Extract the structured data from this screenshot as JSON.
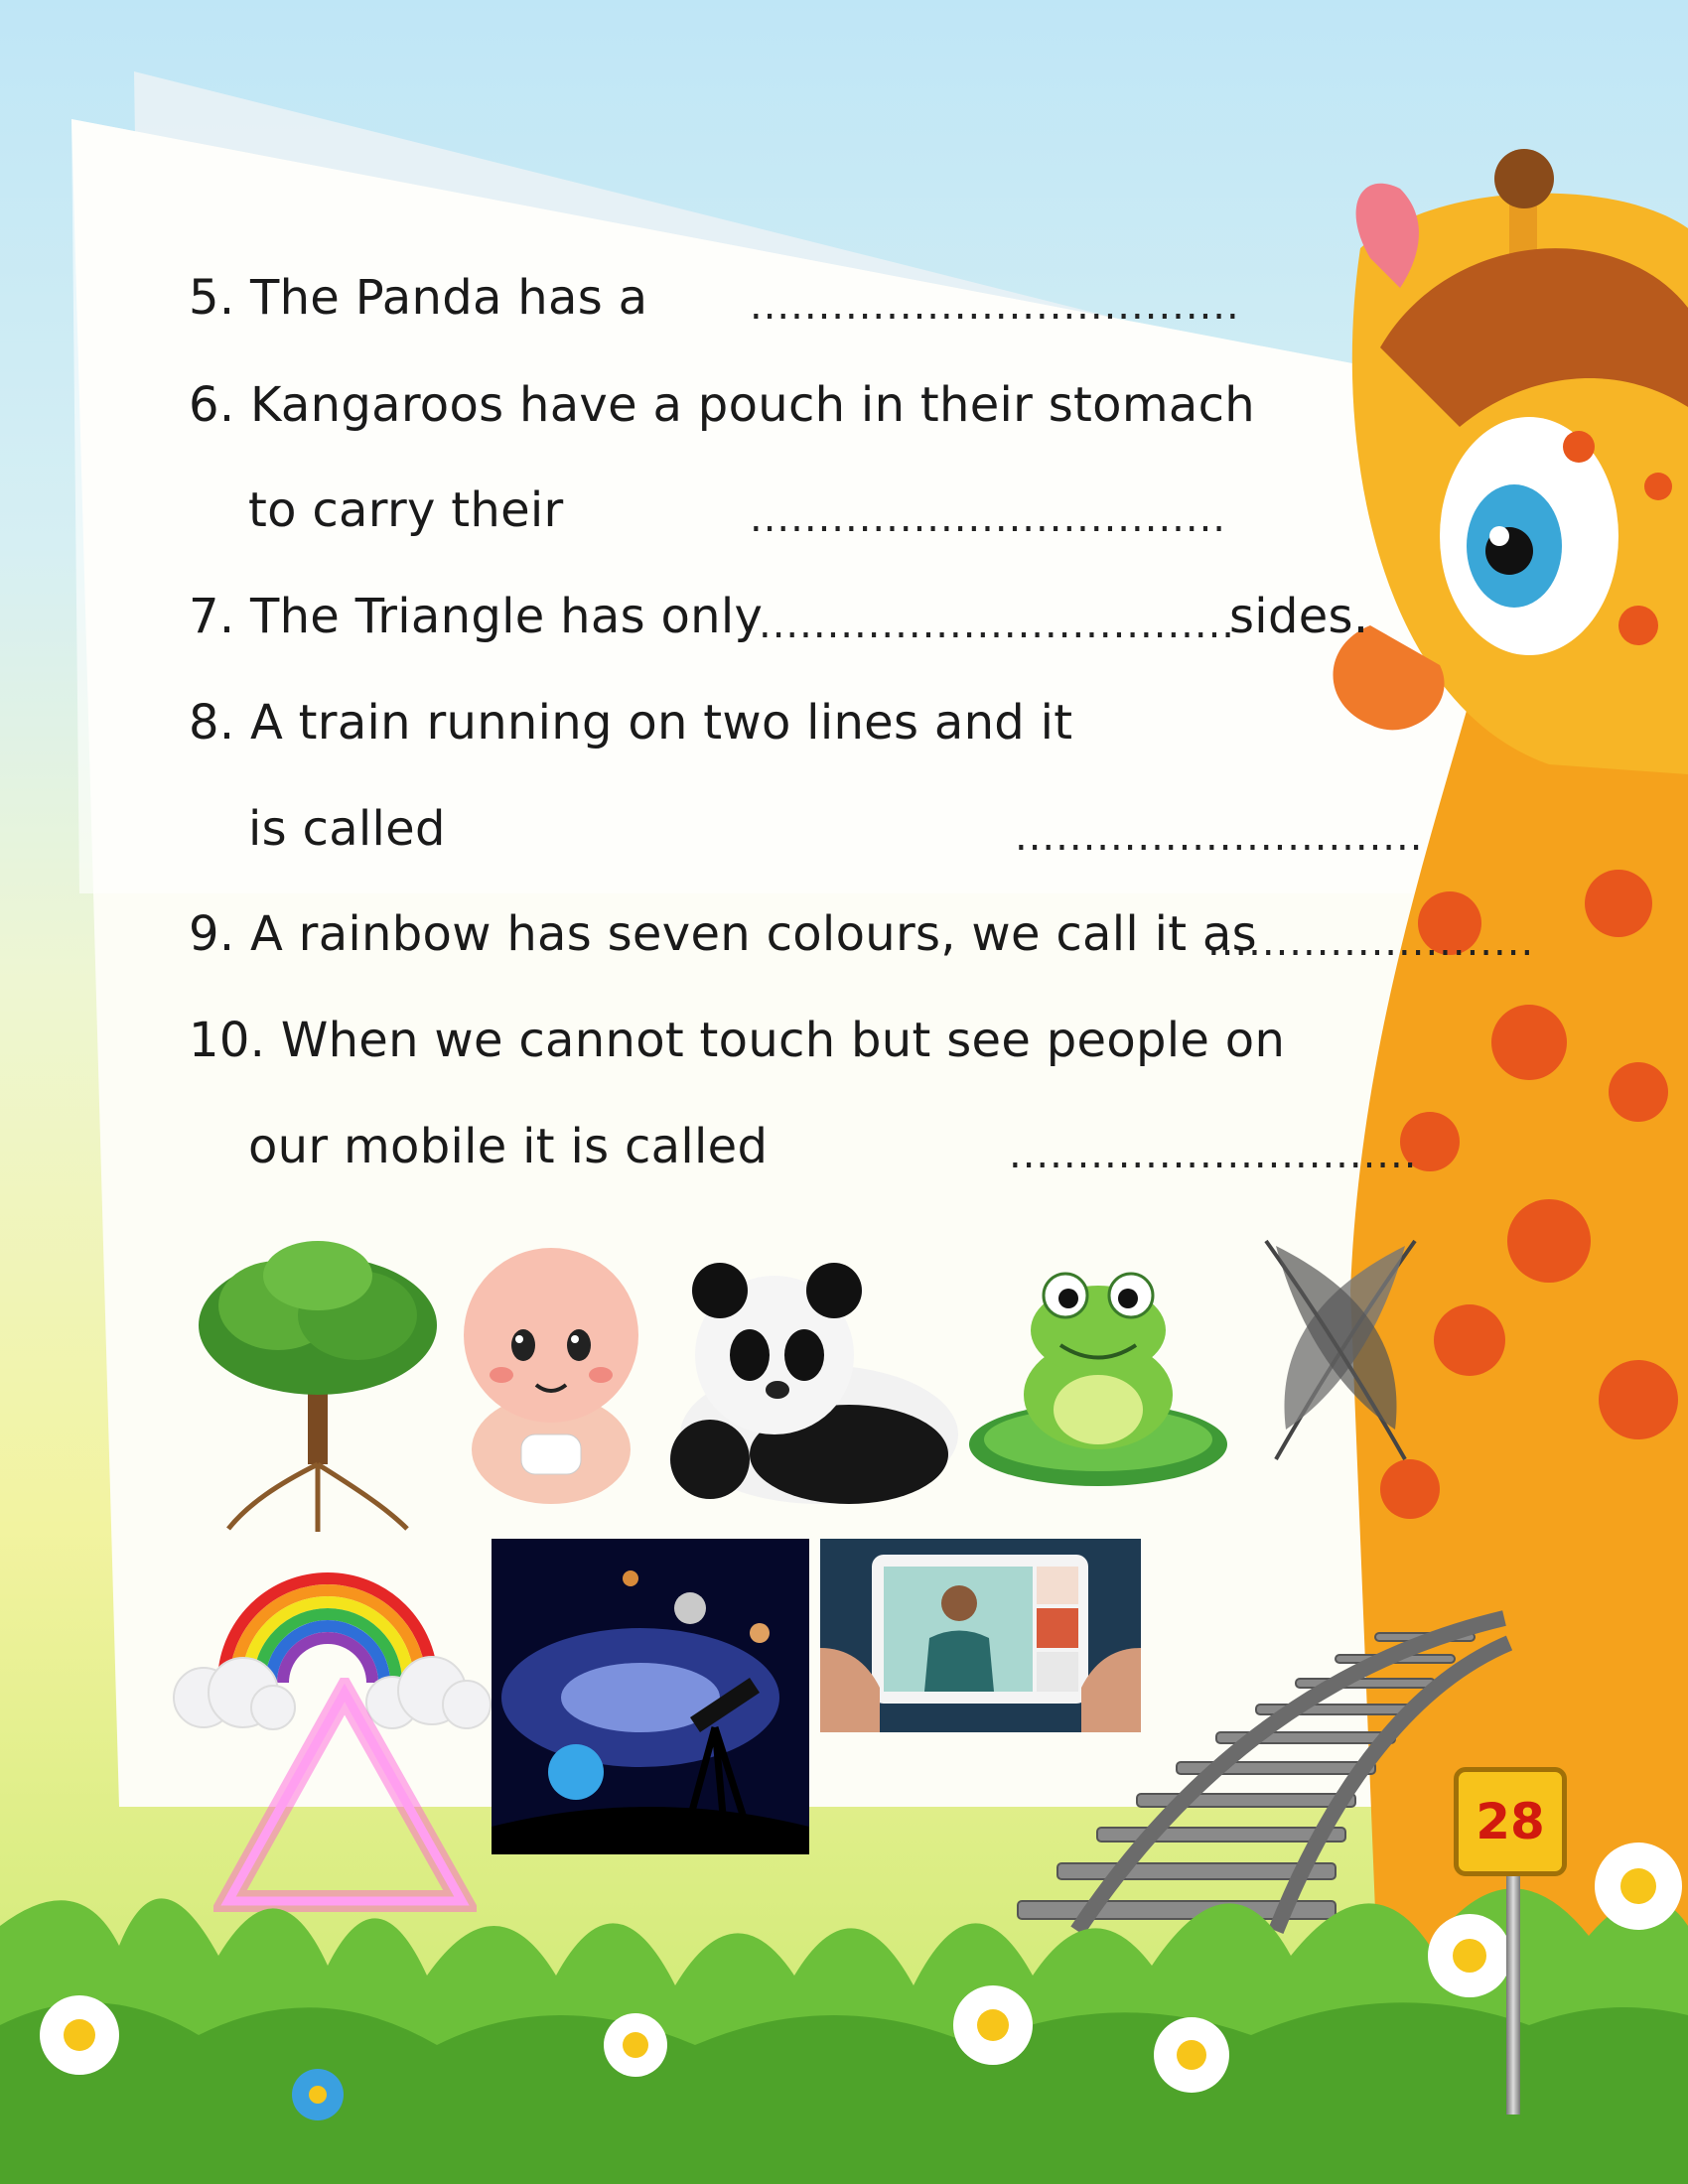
{
  "questions": [
    {
      "num": "5.",
      "text": "The Panda has a",
      "blank": "...................................."
    },
    {
      "num": "6.",
      "text": "Kangaroos have a pouch in their stomach",
      "line2": "to carry their",
      "blank": "..................................."
    },
    {
      "num": "7.",
      "text": "The Triangle has only",
      "blank": "...................................",
      "suffix": "sides."
    },
    {
      "num": "8.",
      "text": "A train running on two lines and it",
      "line2": "is called",
      "blank": ".............................."
    },
    {
      "num": "9.",
      "text": "A rainbow has seven colours, we call it as",
      "blank": "........................"
    },
    {
      "num": "10.",
      "text": "When we cannot touch but see people on",
      "line2": "our mobile it is called",
      "blank": ".............................."
    }
  ],
  "page_number": "28",
  "pictures": [
    "tree",
    "baby",
    "panda",
    "frog",
    "feathers",
    "rainbow",
    "space-telescope",
    "video-call",
    "railway-track",
    "triangle"
  ],
  "colors": {
    "sky": "#bfe6f6",
    "grass": "#6cc03a",
    "giraffe": "#f5a21c",
    "spots": "#e8561c",
    "page_badge": "#f7c31b",
    "page_text": "#d11a0e"
  }
}
